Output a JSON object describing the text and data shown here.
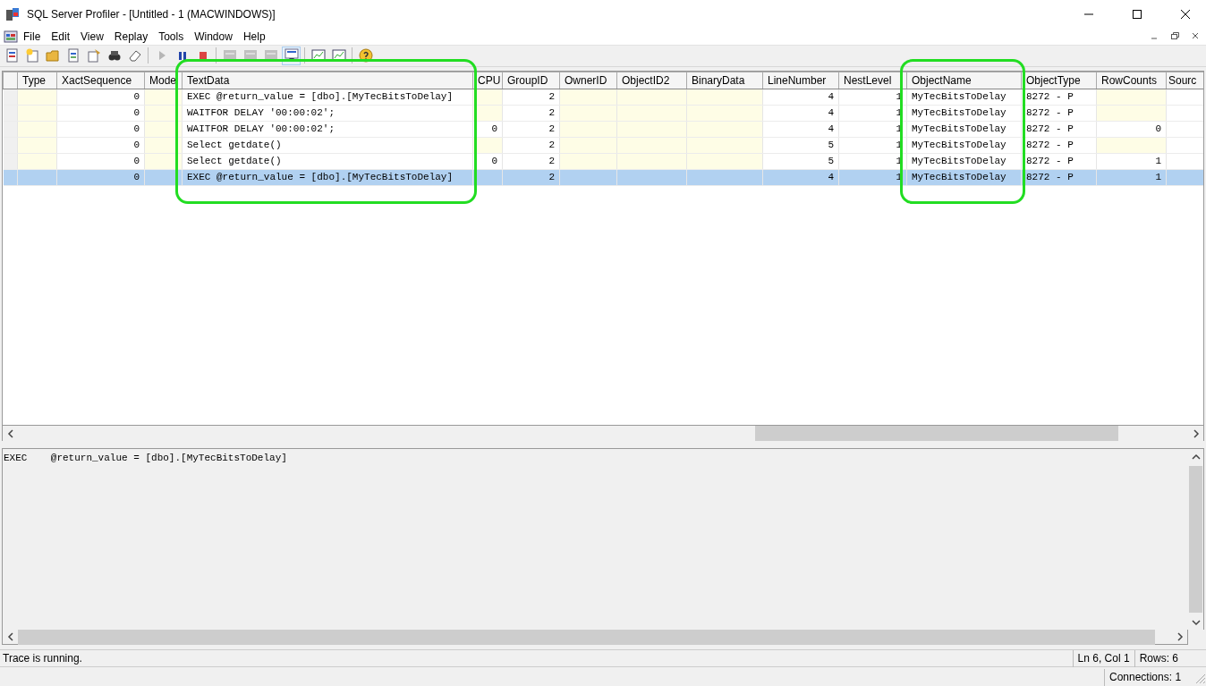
{
  "window": {
    "title": "SQL Server Profiler - [Untitled - 1 (MACWINDOWS)]"
  },
  "menu": [
    "File",
    "Edit",
    "View",
    "Replay",
    "Tools",
    "Window",
    "Help"
  ],
  "toolbar": [
    {
      "kind": "doc"
    },
    {
      "kind": "newdoc"
    },
    {
      "kind": "folder"
    },
    {
      "kind": "template"
    },
    {
      "kind": "props"
    },
    {
      "kind": "binoculars"
    },
    {
      "kind": "eraser"
    },
    {
      "kind": "sep"
    },
    {
      "kind": "play",
      "disabled": true
    },
    {
      "kind": "pause",
      "disabled": false
    },
    {
      "kind": "stop",
      "disabled": false
    },
    {
      "kind": "sep"
    },
    {
      "kind": "grid",
      "disabled": true
    },
    {
      "kind": "grid",
      "disabled": true
    },
    {
      "kind": "grid",
      "disabled": true
    },
    {
      "kind": "scroll",
      "selected": true
    },
    {
      "kind": "sep"
    },
    {
      "kind": "chart"
    },
    {
      "kind": "chart"
    },
    {
      "kind": "sep"
    },
    {
      "kind": "help"
    }
  ],
  "table": {
    "columns": [
      {
        "label": "Type",
        "highlighted": false
      },
      {
        "label": "XactSequence",
        "highlighted": false
      },
      {
        "label": "Mode",
        "highlighted": false
      },
      {
        "label": "TextData",
        "highlighted": true
      },
      {
        "label": "CPU",
        "highlighted": false
      },
      {
        "label": "GroupID",
        "highlighted": false
      },
      {
        "label": "OwnerID",
        "highlighted": false
      },
      {
        "label": "ObjectID2",
        "highlighted": false
      },
      {
        "label": "BinaryData",
        "highlighted": false
      },
      {
        "label": "LineNumber",
        "highlighted": false
      },
      {
        "label": "NestLevel",
        "highlighted": false
      },
      {
        "label": "ObjectName",
        "highlighted": true
      },
      {
        "label": "ObjectType",
        "highlighted": false
      },
      {
        "label": "RowCounts",
        "highlighted": false
      },
      {
        "label": "Sourc",
        "highlighted": false
      }
    ],
    "rows": [
      {
        "selected": false,
        "cells": [
          null,
          "0",
          null,
          "EXEC @return_value = [dbo].[MyTecBitsToDelay]",
          null,
          "2",
          null,
          null,
          null,
          "4",
          "1",
          "MyTecBitsToDelay",
          "8272 - P",
          null
        ]
      },
      {
        "selected": false,
        "cells": [
          null,
          "0",
          null,
          "WAITFOR DELAY '00:00:02';",
          null,
          "2",
          null,
          null,
          null,
          "4",
          "1",
          "MyTecBitsToDelay",
          "8272 - P",
          null
        ]
      },
      {
        "selected": false,
        "cells": [
          null,
          "0",
          null,
          "WAITFOR DELAY '00:00:02';",
          "0",
          "2",
          null,
          null,
          null,
          "4",
          "1",
          "MyTecBitsToDelay",
          "8272 - P",
          "0"
        ]
      },
      {
        "selected": false,
        "cells": [
          null,
          "0",
          null,
          "Select getdate()",
          null,
          "2",
          null,
          null,
          null,
          "5",
          "1",
          "MyTecBitsToDelay",
          "8272 - P",
          null
        ]
      },
      {
        "selected": false,
        "cells": [
          null,
          "0",
          null,
          "Select getdate()",
          "0",
          "2",
          null,
          null,
          null,
          "5",
          "1",
          "MyTecBitsToDelay",
          "8272 - P",
          "1"
        ]
      },
      {
        "selected": true,
        "cells": [
          null,
          "0",
          null,
          "EXEC @return_value = [dbo].[MyTecBitsToDelay]",
          null,
          "2",
          null,
          null,
          null,
          "4",
          "1",
          "MyTecBitsToDelay",
          "8272 - P",
          "1"
        ]
      }
    ]
  },
  "detail_text": "EXEC    @return_value = [dbo].[MyTecBitsToDelay]",
  "status_bar": {
    "message": "Trace is running.",
    "position": "Ln 6, Col 1",
    "rows": "Rows: 6",
    "connections": "Connections: 1"
  }
}
